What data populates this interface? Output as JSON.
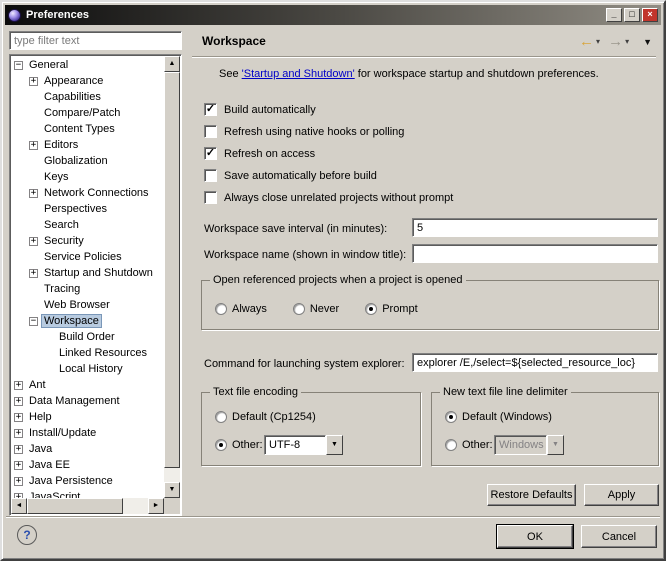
{
  "window": {
    "title": "Preferences"
  },
  "icons": {
    "minimize": "_",
    "maximize": "□",
    "close": "×",
    "back": "←",
    "forward": "→",
    "dropdown_small": "▾",
    "view_menu": "▼",
    "combo_arrow": "▼",
    "scroll_up": "▲",
    "scroll_down": "▼",
    "scroll_left": "◄",
    "scroll_right": "►",
    "check": "✓",
    "expand": "+",
    "collapse": "−",
    "help": "?"
  },
  "sidebar": {
    "filter_placeholder": "type filter text",
    "tree": [
      {
        "label": "General",
        "level": 0,
        "toggle": "minus",
        "selected": false
      },
      {
        "label": "Appearance",
        "level": 1,
        "toggle": "plus",
        "selected": false
      },
      {
        "label": "Capabilities",
        "level": 1,
        "toggle": "none",
        "selected": false
      },
      {
        "label": "Compare/Patch",
        "level": 1,
        "toggle": "none",
        "selected": false
      },
      {
        "label": "Content Types",
        "level": 1,
        "toggle": "none",
        "selected": false
      },
      {
        "label": "Editors",
        "level": 1,
        "toggle": "plus",
        "selected": false
      },
      {
        "label": "Globalization",
        "level": 1,
        "toggle": "none",
        "selected": false
      },
      {
        "label": "Keys",
        "level": 1,
        "toggle": "none",
        "selected": false
      },
      {
        "label": "Network Connections",
        "level": 1,
        "toggle": "plus",
        "selected": false
      },
      {
        "label": "Perspectives",
        "level": 1,
        "toggle": "none",
        "selected": false
      },
      {
        "label": "Search",
        "level": 1,
        "toggle": "none",
        "selected": false
      },
      {
        "label": "Security",
        "level": 1,
        "toggle": "plus",
        "selected": false
      },
      {
        "label": "Service Policies",
        "level": 1,
        "toggle": "none",
        "selected": false
      },
      {
        "label": "Startup and Shutdown",
        "level": 1,
        "toggle": "plus",
        "selected": false
      },
      {
        "label": "Tracing",
        "level": 1,
        "toggle": "none",
        "selected": false
      },
      {
        "label": "Web Browser",
        "level": 1,
        "toggle": "none",
        "selected": false
      },
      {
        "label": "Workspace",
        "level": 1,
        "toggle": "minus",
        "selected": true
      },
      {
        "label": "Build Order",
        "level": 2,
        "toggle": "none",
        "selected": false
      },
      {
        "label": "Linked Resources",
        "level": 2,
        "toggle": "none",
        "selected": false
      },
      {
        "label": "Local History",
        "level": 2,
        "toggle": "none",
        "selected": false
      },
      {
        "label": "Ant",
        "level": 0,
        "toggle": "plus",
        "selected": false
      },
      {
        "label": "Data Management",
        "level": 0,
        "toggle": "plus",
        "selected": false
      },
      {
        "label": "Help",
        "level": 0,
        "toggle": "plus",
        "selected": false
      },
      {
        "label": "Install/Update",
        "level": 0,
        "toggle": "plus",
        "selected": false
      },
      {
        "label": "Java",
        "level": 0,
        "toggle": "plus",
        "selected": false
      },
      {
        "label": "Java EE",
        "level": 0,
        "toggle": "plus",
        "selected": false
      },
      {
        "label": "Java Persistence",
        "level": 0,
        "toggle": "plus",
        "selected": false
      },
      {
        "label": "JavaScript",
        "level": 0,
        "toggle": "plus",
        "selected": false
      }
    ]
  },
  "header": {
    "title": "Workspace"
  },
  "main": {
    "intro": {
      "pre": "See ",
      "link": "'Startup and Shutdown'",
      "post": " for workspace startup and shutdown preferences."
    },
    "checkboxes": [
      {
        "label": "Build automatically",
        "checked": true
      },
      {
        "label": "Refresh using native hooks or polling",
        "checked": false
      },
      {
        "label": "Refresh on access",
        "checked": true
      },
      {
        "label": "Save automatically before build",
        "checked": false
      },
      {
        "label": "Always close unrelated projects without prompt",
        "checked": false
      }
    ],
    "save_interval": {
      "label": "Workspace save interval (in minutes):",
      "value": "5"
    },
    "workspace_name": {
      "label": "Workspace name (shown in window title):",
      "value": ""
    },
    "open_referenced": {
      "title": "Open referenced projects when a project is opened",
      "options": [
        {
          "label": "Always",
          "selected": false
        },
        {
          "label": "Never",
          "selected": false
        },
        {
          "label": "Prompt",
          "selected": true
        }
      ]
    },
    "explorer_command": {
      "label": "Command for launching system explorer:",
      "value": "explorer /E,/select=${selected_resource_loc}"
    },
    "text_file_encoding": {
      "title": "Text file encoding",
      "default_option": {
        "label": "Default (Cp1254)",
        "selected": false
      },
      "other_option": {
        "label": "Other:",
        "selected": true,
        "value": "UTF-8"
      }
    },
    "line_delimiter": {
      "title": "New text file line delimiter",
      "default_option": {
        "label": "Default (Windows)",
        "selected": true
      },
      "other_option": {
        "label": "Other:",
        "selected": false,
        "value": "Windows",
        "enabled": false
      }
    },
    "buttons": {
      "restore_defaults": "Restore Defaults",
      "apply": "Apply"
    }
  },
  "footer": {
    "ok": "OK",
    "cancel": "Cancel"
  }
}
